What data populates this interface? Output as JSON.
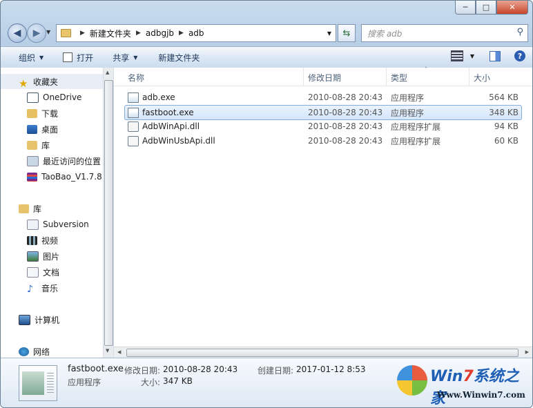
{
  "window": {
    "min": "─",
    "max": "□",
    "close": "✕"
  },
  "address": {
    "crumbs": [
      "新建文件夹",
      "adbgjb",
      "adb"
    ]
  },
  "search": {
    "placeholder": "搜索 adb"
  },
  "toolbar": {
    "organize": "组织",
    "open": "打开",
    "share": "共享",
    "new_folder": "新建文件夹"
  },
  "sidebar": {
    "favorites": "收藏夹",
    "fav_items": [
      "OneDrive",
      "下载",
      "桌面",
      "库",
      "最近访问的位置",
      "TaoBao_V1.7.8."
    ],
    "libraries": "库",
    "lib_items": [
      "Subversion",
      "视频",
      "图片",
      "文档",
      "音乐"
    ],
    "computer": "计算机",
    "network": "网络"
  },
  "columns": {
    "name": "名称",
    "date": "修改日期",
    "type": "类型",
    "size": "大小"
  },
  "files": [
    {
      "name": "adb.exe",
      "date": "2010-08-28 20:43",
      "type": "应用程序",
      "size": "564 KB"
    },
    {
      "name": "fastboot.exe",
      "date": "2010-08-28 20:43",
      "type": "应用程序",
      "size": "348 KB"
    },
    {
      "name": "AdbWinApi.dll",
      "date": "2010-08-28 20:43",
      "type": "应用程序扩展",
      "size": "94 KB"
    },
    {
      "name": "AdbWinUsbApi.dll",
      "date": "2010-08-28 20:43",
      "type": "应用程序扩展",
      "size": "60 KB"
    }
  ],
  "details": {
    "name": "fastboot.exe",
    "kind": "应用程序",
    "mod_label": "修改日期:",
    "mod_value": "2010-08-28 20:43",
    "create_label": "创建日期:",
    "create_value": "2017-01-12 8:53",
    "size_label": "大小:",
    "size_value": "347 KB"
  },
  "watermark": {
    "brand_a": "Win",
    "brand_b": "7",
    "brand_c": "系统之家",
    "url": "Www.Winwin7.com"
  }
}
